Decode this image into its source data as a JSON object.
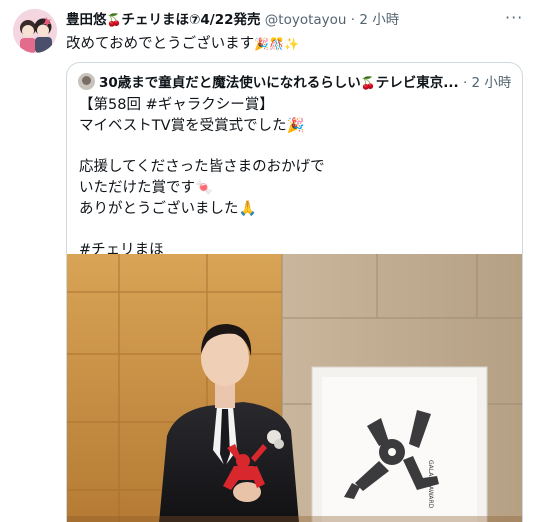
{
  "tweet": {
    "display_name": "豊田悠",
    "name_suffix": "チェリまほ⑦4/22発売",
    "handle": "@toyotayou",
    "separator": "·",
    "time": "2 小時",
    "more": "···",
    "text": "改めておめでとうございます",
    "text_emojis": [
      "🎉",
      "🎊",
      "✨"
    ],
    "name_emoji": "🍒"
  },
  "quoted": {
    "name_prefix": "30歳まで童貞だと魔法使いになれるらしい",
    "name_emoji": "🍒",
    "name_suffix": "テレビ東京...",
    "separator": "·",
    "time": "2 小時",
    "lines": [
      "【第58回 #ギャラクシー賞】",
      "マイベストTV賞を受賞式でした🎉",
      "",
      "応援してくださった皆さまのおかげで",
      "いただけた賞です🍬",
      "ありがとうございました🙏",
      "",
      "#チェリまほ"
    ],
    "photo_alt": "Actor in a black suit holding a red award statue beside a Galaxy Award poster"
  },
  "colors": {
    "text": "#0f1419",
    "secondary": "#536471",
    "border": "#cfd9de",
    "award_red": "#d8272d",
    "wall_gold": "#cf9a4a"
  }
}
